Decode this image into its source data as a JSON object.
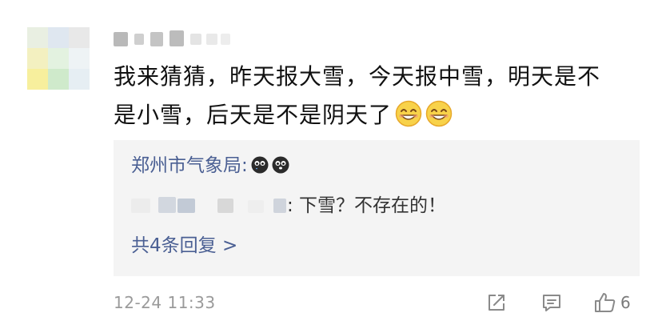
{
  "comment": {
    "text_line_1": "我来猜猜，昨天报大雪，今天报中雪，明天是不",
    "text_line_2": "是小雪，后天是不是阴天了",
    "emojis": [
      "grin-icon",
      "grin-icon"
    ]
  },
  "replies": {
    "official_author": "郑州市气象局:",
    "official_emojis": [
      "black-face-icon",
      "black-face-icon"
    ],
    "reply_text": ": 下雪？不存在的！",
    "more_label": "共4条回复 >"
  },
  "footer": {
    "timestamp": "12-24 11:33",
    "like_count": "6"
  },
  "colors": {
    "link_blue": "#4a5f93",
    "text": "#111111",
    "muted": "#9a9a9a",
    "reply_bg": "#f4f4f4"
  },
  "icons": {
    "share": "share-icon",
    "comment": "comment-icon",
    "like": "thumbs-up-icon"
  }
}
